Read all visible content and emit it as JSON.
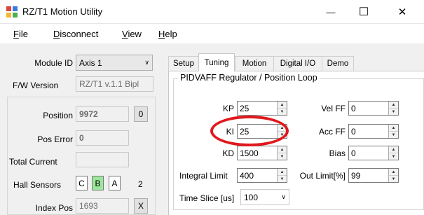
{
  "window": {
    "title": "RZ/T1 Motion Utility",
    "minimize_glyph": "—",
    "maximize_glyph": "☐",
    "close_glyph": "✕"
  },
  "menu": [
    {
      "label": "File",
      "accel": "F",
      "rest": "ile"
    },
    {
      "label": "Disconnect",
      "accel": "D",
      "rest": "isconnect"
    },
    {
      "label": "View",
      "accel": "V",
      "rest": "iew"
    },
    {
      "label": "Help",
      "accel": "H",
      "rest": "elp"
    }
  ],
  "left": {
    "module_id_label": "Module ID",
    "module_id_value": "Axis 1",
    "fw_version_label": "F/W Version",
    "fw_version_value": "RZ/T1 v.1.1 Bipl",
    "position_label": "Position",
    "position_value": "9972",
    "position_reset": "0",
    "pos_error_label": "Pos Error",
    "pos_error_value": "0",
    "total_current_label": "Total Current",
    "total_current_value": "",
    "hall_label": "Hall Sensors",
    "hall": [
      "C",
      "B",
      "A"
    ],
    "hall_active_index": 1,
    "hall_number": "2",
    "index_pos_label": "Index Pos",
    "index_pos_value": "1693",
    "index_pos_clear": "X"
  },
  "tabs": {
    "items": [
      "Setup",
      "Tuning",
      "Motion",
      "Digital I/O",
      "Demo"
    ],
    "active": "Tuning"
  },
  "tuning": {
    "group_title": "PIDVAFF Regulator / Position Loop",
    "kp_label": "KP",
    "kp_value": "25",
    "ki_label": "KI",
    "ki_value": "25",
    "kd_label": "KD",
    "kd_value": "1500",
    "vel_ff_label": "Vel FF",
    "vel_ff_value": "0",
    "acc_ff_label": "Acc FF",
    "acc_ff_value": "0",
    "bias_label": "Bias",
    "bias_value": "0",
    "integral_limit_label": "Integral Limit",
    "integral_limit_value": "400",
    "out_limit_label": "Out Limit[%]",
    "out_limit_value": "99",
    "time_slice_label": "Time Slice [us]",
    "time_slice_value": "100"
  },
  "colors": {
    "highlight_ring": "#e0191e",
    "hall_active": "#9be89b"
  }
}
